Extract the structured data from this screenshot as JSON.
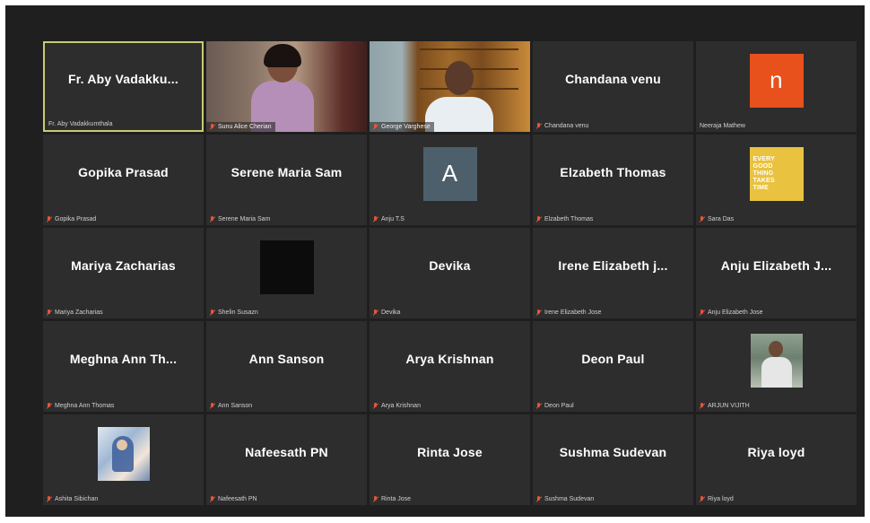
{
  "participants": [
    {
      "display": "Fr. Aby Vadakku...",
      "label": "Fr. Aby Vadakkumthala",
      "muted": false,
      "active": true,
      "kind": "text"
    },
    {
      "display": "",
      "label": "Sunu Alice Cherian",
      "muted": true,
      "kind": "video1"
    },
    {
      "display": "",
      "label": "George Varghese",
      "muted": true,
      "kind": "video2"
    },
    {
      "display": "Chandana venu",
      "label": "Chandana venu",
      "muted": true,
      "kind": "text"
    },
    {
      "display": "n",
      "label": "Neeraja Mathew",
      "muted": false,
      "kind": "avatar-orange"
    },
    {
      "display": "Gopika Prasad",
      "label": "Gopika Prasad",
      "muted": true,
      "kind": "text"
    },
    {
      "display": "Serene Maria Sam",
      "label": "Serene Maria Sam",
      "muted": true,
      "kind": "text"
    },
    {
      "display": "A",
      "label": "Anju T.S",
      "muted": true,
      "kind": "avatar-slate"
    },
    {
      "display": "Elzabeth Thomas",
      "label": "Elzabeth Thomas",
      "muted": true,
      "kind": "text"
    },
    {
      "display": "EVERY GOOD THING TAKES TIME",
      "label": "Sara Das",
      "muted": true,
      "kind": "avatar-yellow"
    },
    {
      "display": "Mariya Zacharias",
      "label": "Mariya Zacharias",
      "muted": true,
      "kind": "text"
    },
    {
      "display": "",
      "label": "Shelin Susazn",
      "muted": true,
      "kind": "avatar-dark"
    },
    {
      "display": "Devika",
      "label": "Devika",
      "muted": true,
      "kind": "text"
    },
    {
      "display": "Irene Elizabeth j...",
      "label": "Irene Elizabeth Jose",
      "muted": true,
      "kind": "text"
    },
    {
      "display": "Anju Elizabeth J...",
      "label": "Anju Elizabeth Jose",
      "muted": true,
      "kind": "text"
    },
    {
      "display": "Meghna Ann Th...",
      "label": "Meghna Ann Thomas",
      "muted": true,
      "kind": "text"
    },
    {
      "display": "Ann Sanson",
      "label": "Ann Sanson",
      "muted": true,
      "kind": "text"
    },
    {
      "display": "Arya Krishnan",
      "label": "Arya Krishnan",
      "muted": true,
      "kind": "text"
    },
    {
      "display": "Deon Paul",
      "label": "Deon Paul",
      "muted": true,
      "kind": "text"
    },
    {
      "display": "",
      "label": "ARJUN VIJITH",
      "muted": true,
      "kind": "photo-man"
    },
    {
      "display": "",
      "label": "Ashita Sibichan",
      "muted": true,
      "kind": "photo-paint"
    },
    {
      "display": "Nafeesath PN",
      "label": "Nafeesath PN",
      "muted": true,
      "kind": "text"
    },
    {
      "display": "Rinta Jose",
      "label": "Rinta Jose",
      "muted": true,
      "kind": "text"
    },
    {
      "display": "Sushma Sudevan",
      "label": "Sushma Sudevan",
      "muted": true,
      "kind": "text"
    },
    {
      "display": "Riya loyd",
      "label": "Riya loyd",
      "muted": true,
      "kind": "text"
    }
  ],
  "colors": {
    "background": "#1f1f1f",
    "tile": "#2d2d2d",
    "active_border": "#c6cc73",
    "mic_muted": "#e8553a",
    "avatar_orange": "#e8501c",
    "avatar_slate": "#4d5f6b",
    "avatar_yellow": "#e9c23f"
  },
  "icons": {
    "muted": "mic-off-icon"
  }
}
